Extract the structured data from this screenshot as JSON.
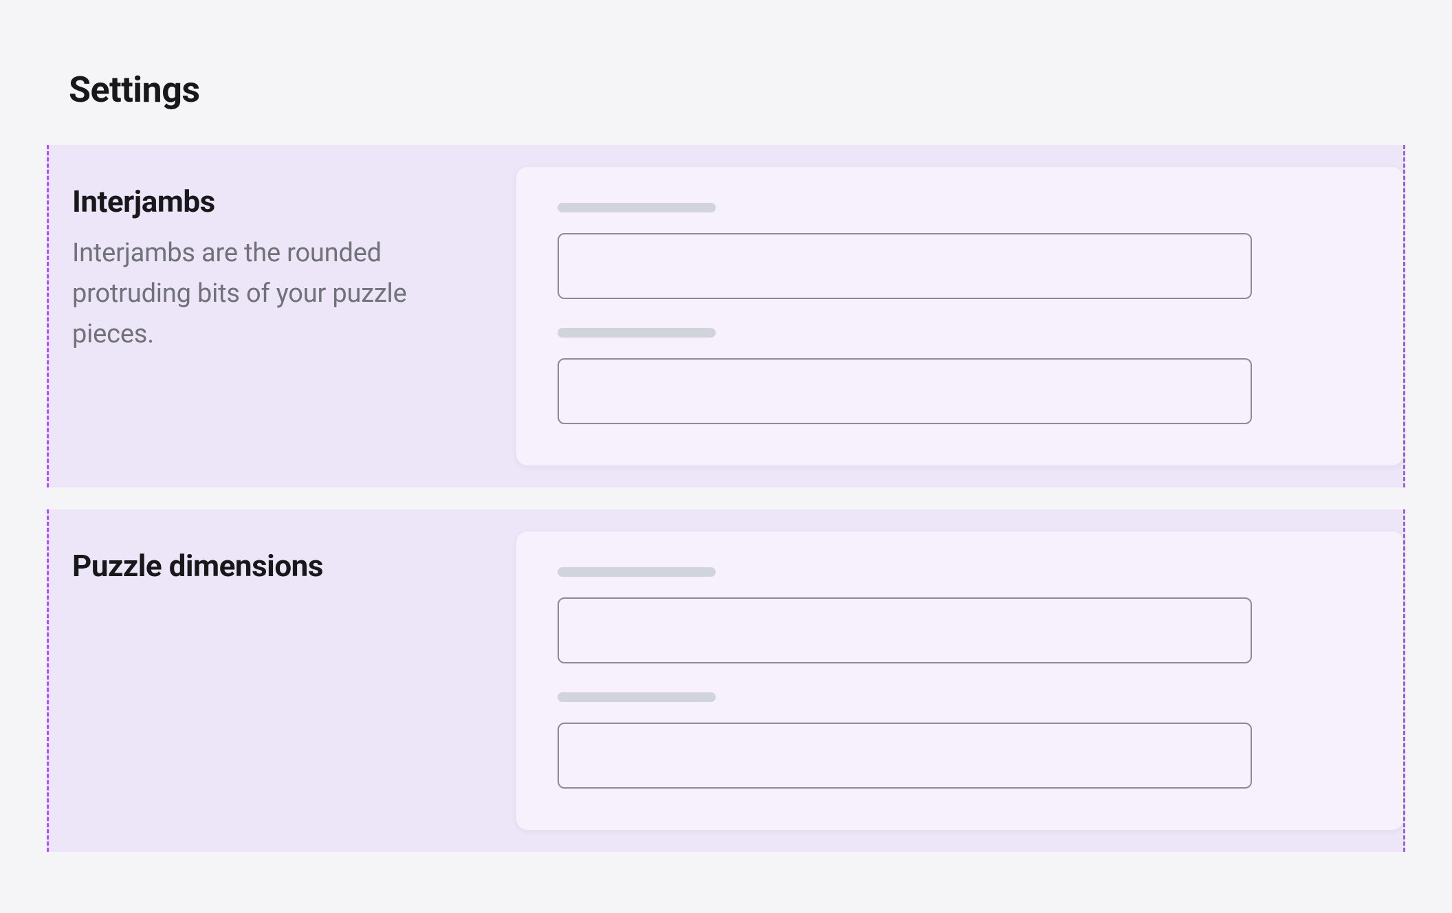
{
  "page": {
    "title": "Settings"
  },
  "sections": [
    {
      "title": "Interjambs",
      "description": "Interjambs are the rounded protruding bits of your puzzle pieces.",
      "fields": [
        {
          "label": "",
          "value": ""
        },
        {
          "label": "",
          "value": ""
        }
      ]
    },
    {
      "title": "Puzzle dimensions",
      "description": "",
      "fields": [
        {
          "label": "",
          "value": ""
        },
        {
          "label": "",
          "value": ""
        }
      ]
    }
  ]
}
